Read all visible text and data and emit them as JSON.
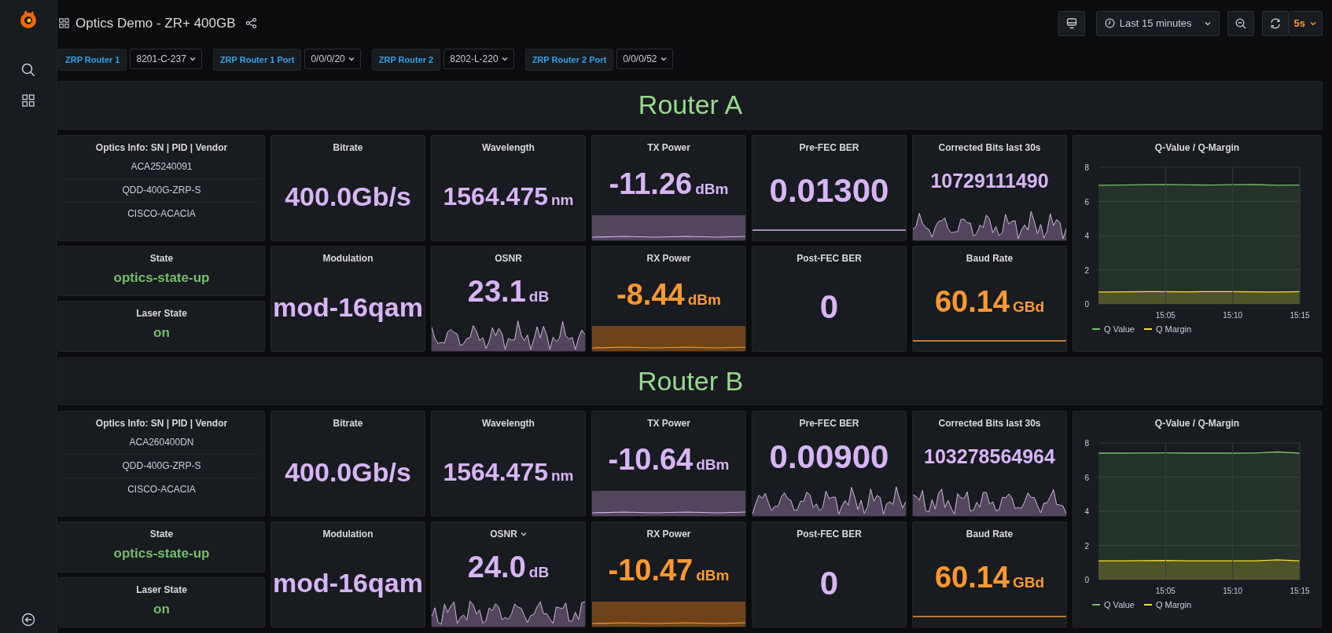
{
  "dashboard": {
    "title": "Optics Demo - ZR+ 400GB"
  },
  "time_picker": {
    "range": "Last 15 minutes",
    "refresh_interval": "5s"
  },
  "variables": [
    {
      "label": "ZRP Router 1",
      "value": "8201-C-237"
    },
    {
      "label": "ZRP Router 1 Port",
      "value": "0/0/0/20"
    },
    {
      "label": "ZRP Router 2",
      "value": "8202-L-220"
    },
    {
      "label": "ZRP Router 2 Port",
      "value": "0/0/0/52"
    }
  ],
  "routers": [
    {
      "title": "Router A",
      "info": {
        "title": "Optics Info: SN | PID | Vendor",
        "items": [
          "ACA25240091",
          "QDD-400G-ZRP-S",
          "CISCO-ACACIA"
        ]
      },
      "state": {
        "title": "State",
        "value": "optics-state-up"
      },
      "laser": {
        "title": "Laser State",
        "value": "on"
      },
      "stats": [
        {
          "title": "Bitrate",
          "value": "400.0Gb/s",
          "color": "#d8b4f5",
          "kind": "none",
          "menu": false
        },
        {
          "title": "Wavelength",
          "value": "1564.475",
          "unit": "nm",
          "color": "#d8b4f5",
          "kind": "none",
          "menu": false
        },
        {
          "title": "TX Power",
          "value": "-11.26",
          "unit": "dBm",
          "color": "#d8b4f5",
          "kind": "area",
          "menu": false
        },
        {
          "title": "Pre-FEC BER",
          "value": "0.01300",
          "color": "#d8b4f5",
          "kind": "line",
          "menu": false
        },
        {
          "title": "Corrected Bits last 30s",
          "value": "10729111490",
          "color": "#d8b4f5",
          "kind": "wave",
          "menu": false
        },
        {
          "title": "Modulation",
          "value": "mod-16qam",
          "color": "#d8b4f5",
          "kind": "none",
          "menu": false
        },
        {
          "title": "OSNR",
          "value": "23.1",
          "unit": "dB",
          "color": "#d8b4f5",
          "kind": "wave",
          "menu": false
        },
        {
          "title": "RX Power",
          "value": "-8.44",
          "unit": "dBm",
          "color": "#ff9830",
          "kind": "area",
          "menu": false
        },
        {
          "title": "Post-FEC BER",
          "value": "0",
          "color": "#d8b4f5",
          "kind": "none",
          "menu": false
        },
        {
          "title": "Baud Rate",
          "value": "60.14",
          "unit": "GBd",
          "color": "#ff9830",
          "kind": "line",
          "menu": false
        }
      ],
      "chart": {
        "title": "Q-Value / Q-Margin",
        "chart_data": {
          "type": "area",
          "legend": "bottom left",
          "grid": true,
          "categories": [
            null,
            null,
            null,
            "15:05",
            null,
            null,
            "15:10",
            null,
            null,
            "15:15"
          ],
          "ylim": [
            0,
            8
          ],
          "yticks": [
            0,
            2,
            4,
            6,
            8
          ],
          "series": [
            {
              "name": "Q Value",
              "color": "#73bf69",
              "values": [
                6.95,
                6.96,
                6.98,
                7.0,
                6.97,
                6.96,
                6.98,
                6.99,
                6.95,
                6.96
              ]
            },
            {
              "name": "Q Margin",
              "color": "#fade2a",
              "values": [
                0.7,
                0.71,
                0.72,
                0.72,
                0.71,
                0.72,
                0.72,
                0.71,
                0.7,
                0.72
              ]
            }
          ]
        }
      }
    },
    {
      "title": "Router B",
      "info": {
        "title": "Optics Info: SN | PID | Vendor",
        "items": [
          "ACA260400DN",
          "QDD-400G-ZRP-S",
          "CISCO-ACACIA"
        ]
      },
      "state": {
        "title": "State",
        "value": "optics-state-up"
      },
      "laser": {
        "title": "Laser State",
        "value": "on"
      },
      "stats": [
        {
          "title": "Bitrate",
          "value": "400.0Gb/s",
          "color": "#d8b4f5",
          "kind": "none",
          "menu": false
        },
        {
          "title": "Wavelength",
          "value": "1564.475",
          "unit": "nm",
          "color": "#d8b4f5",
          "kind": "none",
          "menu": false
        },
        {
          "title": "TX Power",
          "value": "-10.64",
          "unit": "dBm",
          "color": "#d8b4f5",
          "kind": "area",
          "menu": false
        },
        {
          "title": "Pre-FEC BER",
          "value": "0.00900",
          "color": "#d8b4f5",
          "kind": "wave",
          "menu": false
        },
        {
          "title": "Corrected Bits last 30s",
          "value": "103278564964",
          "color": "#d8b4f5",
          "kind": "wave",
          "menu": false
        },
        {
          "title": "Modulation",
          "value": "mod-16qam",
          "color": "#d8b4f5",
          "kind": "none",
          "menu": false
        },
        {
          "title": "OSNR",
          "value": "24.0",
          "unit": "dB",
          "color": "#d8b4f5",
          "kind": "wave",
          "menu": true
        },
        {
          "title": "RX Power",
          "value": "-10.47",
          "unit": "dBm",
          "color": "#ff9830",
          "kind": "area",
          "menu": false
        },
        {
          "title": "Post-FEC BER",
          "value": "0",
          "color": "#d8b4f5",
          "kind": "none",
          "menu": false
        },
        {
          "title": "Baud Rate",
          "value": "60.14",
          "unit": "GBd",
          "color": "#ff9830",
          "kind": "line",
          "menu": false
        }
      ],
      "chart": {
        "title": "Q-Value / Q-Margin",
        "chart_data": {
          "type": "area",
          "legend": "bottom left",
          "grid": true,
          "categories": [
            null,
            null,
            null,
            "15:05",
            null,
            null,
            "15:10",
            null,
            null,
            "15:15"
          ],
          "ylim": [
            0,
            8
          ],
          "yticks": [
            0,
            2,
            4,
            6,
            8
          ],
          "series": [
            {
              "name": "Q Value",
              "color": "#73bf69",
              "values": [
                7.4,
                7.4,
                7.41,
                7.42,
                7.4,
                7.4,
                7.4,
                7.41,
                7.47,
                7.4
              ]
            },
            {
              "name": "Q Margin",
              "color": "#fade2a",
              "values": [
                1.1,
                1.1,
                1.11,
                1.12,
                1.1,
                1.1,
                1.1,
                1.1,
                1.16,
                1.1
              ]
            }
          ]
        }
      }
    }
  ]
}
